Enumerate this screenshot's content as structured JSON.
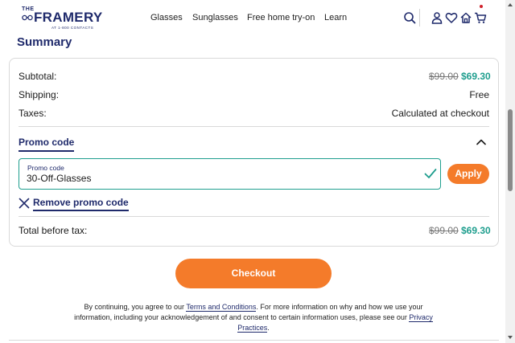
{
  "header": {
    "logo": {
      "the": "THE",
      "brand": "FRAMERY",
      "sub": "AT 1-800 CONTACTS"
    },
    "nav": [
      "Glasses",
      "Sunglasses",
      "Free home try-on",
      "Learn"
    ],
    "icons": [
      "search-icon",
      "account-icon",
      "heart-icon",
      "home-icon",
      "cart-icon"
    ]
  },
  "summary": {
    "title": "Summary",
    "subtotal": {
      "label": "Subtotal:",
      "original": "$99.00",
      "price": "$69.30"
    },
    "shipping": {
      "label": "Shipping:",
      "value": "Free"
    },
    "taxes": {
      "label": "Taxes:",
      "value": "Calculated at checkout"
    },
    "promo": {
      "toggle_label": "Promo code",
      "field_label": "Promo code",
      "field_value": "30-Off-Glasses",
      "apply_label": "Apply",
      "remove_label": "Remove promo code"
    },
    "total": {
      "label": "Total before tax:",
      "original": "$99.00",
      "price": "$69.30"
    }
  },
  "checkout": {
    "label": "Checkout"
  },
  "legal": {
    "part1": "By continuing, you agree to our ",
    "terms_link": "Terms and Conditions",
    "part2": ". For more information on why and how we use your information, including your acknowledgement of and consent to certain information uses, please see our ",
    "privacy_link": "Privacy Practices",
    "part3": "."
  },
  "colors": {
    "brand_navy": "#1f2a6b",
    "accent_orange": "#f47b2a",
    "price_teal": "#1f9e8e",
    "notification_red": "#d0202a"
  }
}
